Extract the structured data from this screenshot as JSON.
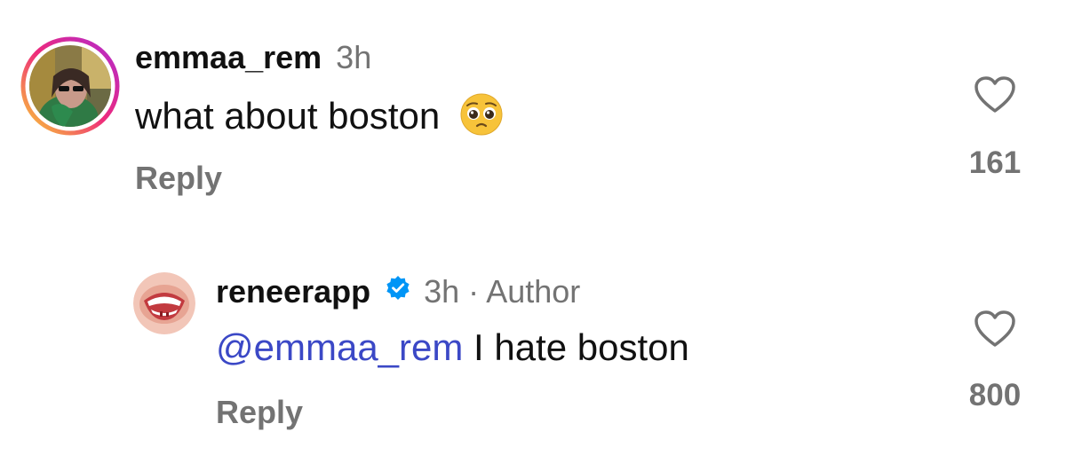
{
  "comments": [
    {
      "username": "emmaa_rem",
      "time": "3h",
      "text": "what about boston",
      "emoji": "pleading-face",
      "reply_label": "Reply",
      "likes": "161"
    },
    {
      "username": "reneerapp",
      "verified": true,
      "time": "3h",
      "separator": "·",
      "role": "Author",
      "mention": "@emmaa_rem",
      "text": "I hate boston",
      "reply_label": "Reply",
      "likes": "800"
    }
  ],
  "colors": {
    "username": "#111111",
    "muted": "#737373",
    "mention": "#3b48c6",
    "verified": "#0095f6",
    "ring_start": "#f9ce34",
    "ring_mid": "#ee2a7b",
    "ring_end": "#6228d7"
  },
  "icons": [
    "heart-icon",
    "verified-badge-icon",
    "pleading-face-emoji"
  ]
}
